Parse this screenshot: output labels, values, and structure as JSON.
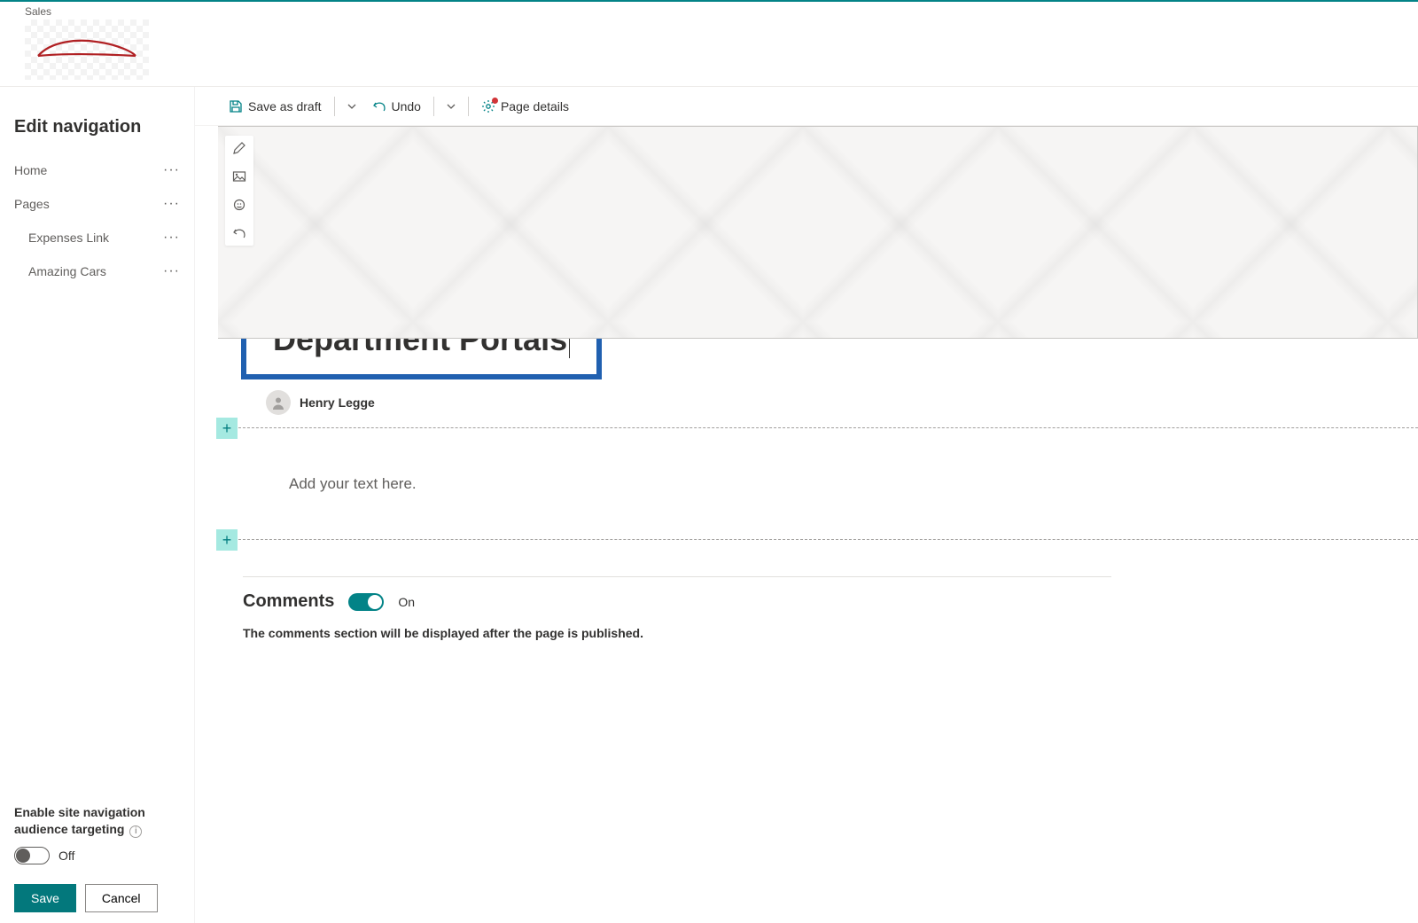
{
  "site": {
    "label": "Sales"
  },
  "sidebar": {
    "title": "Edit navigation",
    "items": [
      {
        "label": "Home",
        "indent": false
      },
      {
        "label": "Pages",
        "indent": false
      },
      {
        "label": "Expenses Link",
        "indent": true
      },
      {
        "label": "Amazing Cars",
        "indent": true
      }
    ],
    "audience_label_line1": "Enable site navigation",
    "audience_label_line2": "audience targeting",
    "audience_state": "Off",
    "save": "Save",
    "cancel": "Cancel"
  },
  "cmdbar": {
    "save_draft": "Save as draft",
    "undo": "Undo",
    "page_details": "Page details"
  },
  "page": {
    "title": "Department Portals",
    "author": "Henry Legge",
    "text_placeholder": "Add your text here."
  },
  "comments": {
    "heading": "Comments",
    "state": "On",
    "note": "The comments section will be displayed after the page is published."
  }
}
